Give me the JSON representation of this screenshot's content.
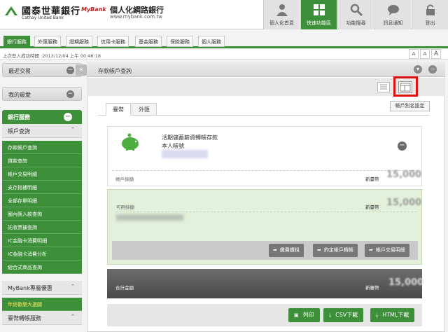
{
  "header": {
    "bank_name": "國泰世華銀行",
    "bank_en": "Cathay United Bank",
    "mybank_logo": "MyBank",
    "portal_name": "個人化網路銀行",
    "portal_url": "www.mybank.com.tw",
    "nav": [
      {
        "label": "個人化首頁",
        "icon": "person-icon"
      },
      {
        "label": "快速功能區",
        "icon": "quick-menu-icon"
      },
      {
        "label": "功能搜尋",
        "icon": "search-icon"
      },
      {
        "label": "訊息通知",
        "icon": "message-icon"
      },
      {
        "label": "登出",
        "icon": "lock-icon"
      }
    ]
  },
  "service_tabs": [
    "銀行服務",
    "外匯服務",
    "證期服務",
    "信用卡服務",
    "基金服務",
    "保險服務",
    "個人服務"
  ],
  "login_bar": {
    "text": "上次登入成功時間 :2013/12/04 上午 00:46:18",
    "font_buttons": [
      "A",
      "A",
      "A"
    ]
  },
  "sidebar": {
    "recent": "最近交易",
    "favorites": "我的最愛",
    "bank_services": "銀行服務",
    "account_inquiry": "帳戶查詢",
    "items": [
      "存款帳戶查詢",
      "貸款查詢",
      "帳戶交易明細",
      "支存指補明細",
      "全部存單明細",
      "國內匯入款查詢",
      "託收票據查詢",
      "IC金融卡消費明細",
      "IC金融卡消費分析",
      "組合式商品查詢"
    ],
    "mybank_offers": "MyBank專屬優惠",
    "offer_item": "年終歡樂大選願",
    "transfer_services": "臺幣轉帳服務",
    "collapse_symbol": "«",
    "minus_symbol": "−",
    "caret_symbol": "^"
  },
  "main": {
    "title": "存款帳戶查詢",
    "alias_button": "帳戶別名設定",
    "tabs": [
      "臺幣",
      "外匯"
    ],
    "account": {
      "name": "活期儲蓄薪資轉帳存款",
      "owner": "本人帳號",
      "balance_label": "帳戶餘額",
      "currency": "新臺幣",
      "balance": "15,000"
    },
    "available": {
      "label": "可用餘額",
      "currency": "新臺幣",
      "balance": "15,000"
    },
    "actions": [
      "繳費繳稅",
      "約定帳戶轉帳",
      "帳戶交易明細"
    ],
    "total": {
      "label": "合計金額",
      "currency": "新臺幣",
      "value": "15,000"
    },
    "bottom_buttons": [
      "列印",
      "CSV下載",
      "HTML下載"
    ],
    "colors": {
      "brand_green": "#3d8f3a",
      "highlight_red": "#e01010"
    }
  }
}
